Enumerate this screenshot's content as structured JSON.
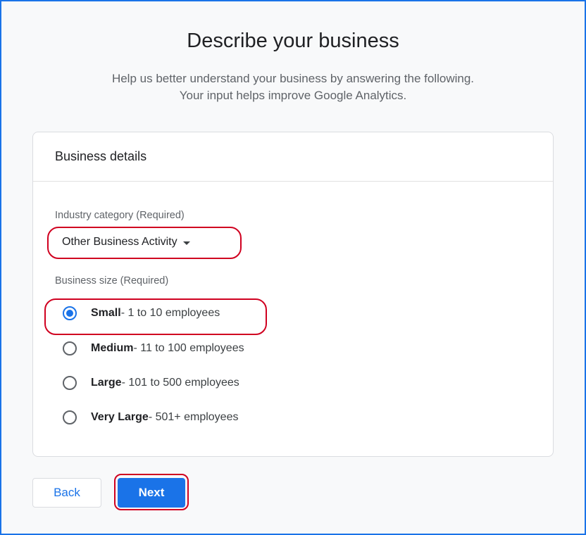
{
  "page": {
    "title": "Describe your business",
    "subtitle_line1": "Help us better understand your business by answering the following.",
    "subtitle_line2": "Your input helps improve Google Analytics."
  },
  "card": {
    "header": "Business details",
    "industry": {
      "label": "Industry category (Required)",
      "selected": "Other Business Activity",
      "icon": "caret-down-icon"
    },
    "size": {
      "label": "Business size (Required)",
      "options": [
        {
          "name": "Small",
          "desc": " - 1 to 10 employees",
          "checked": true
        },
        {
          "name": "Medium",
          "desc": " - 11 to 100 employees",
          "checked": false
        },
        {
          "name": "Large",
          "desc": " - 101 to 500 employees",
          "checked": false
        },
        {
          "name": "Very Large",
          "desc": " - 501+ employees",
          "checked": false
        }
      ]
    }
  },
  "buttons": {
    "back": "Back",
    "next": "Next"
  },
  "colors": {
    "accent": "#1a73e8",
    "highlight": "#d00020",
    "frame": "#1a73e8"
  }
}
